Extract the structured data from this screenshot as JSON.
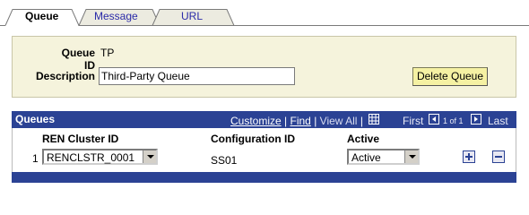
{
  "tabs": [
    {
      "label": "Queue",
      "active": true
    },
    {
      "label": "Message",
      "active": false
    },
    {
      "label": "URL",
      "active": false
    }
  ],
  "header": {
    "queue_id_label": "Queue ID",
    "queue_id_value": "TP",
    "description_label": "Description",
    "description_value": "Third-Party Queue",
    "delete_button": "Delete Queue"
  },
  "grid": {
    "title": "Queues",
    "customize": "Customize",
    "find": "Find",
    "view_all": "View All",
    "sep": "|",
    "first": "First",
    "range": "1 of 1",
    "last": "Last",
    "columns": [
      "REN Cluster ID",
      "Configuration ID",
      "Active"
    ],
    "rows": [
      {
        "num": "1",
        "cluster": "RENCLSTR_0001",
        "config": "SS01",
        "active": "Active"
      }
    ]
  },
  "colors": {
    "grid_header": "#2b4294",
    "panel_bg": "#f5f3dc",
    "button_bg": "#f5f1a3",
    "link": "#2a2aa8"
  }
}
